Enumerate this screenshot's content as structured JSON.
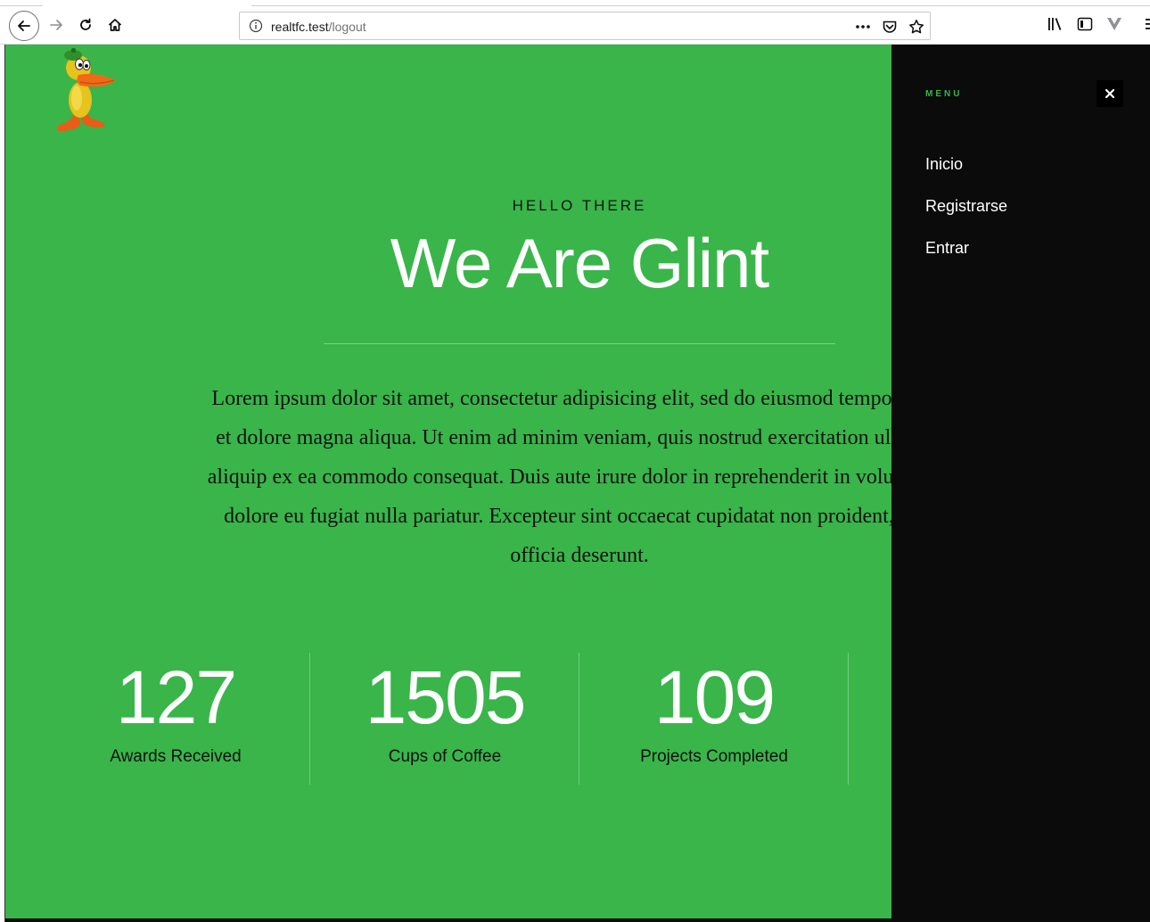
{
  "browser": {
    "url_host": "realtfc.test",
    "url_path": "/logout"
  },
  "hero": {
    "eyebrow": "HELLO THERE",
    "headline": "We Are Glint",
    "intro_lines": [
      "Lorem ipsum dolor sit amet, consectetur adipisicing elit, sed do eiusmod tempor incid",
      "et dolore magna aliqua. Ut enim ad minim veniam, quis nostrud exercitation ullamco",
      "aliquip ex ea commodo consequat. Duis aute irure dolor in reprehenderit in voluptate v",
      "dolore eu fugiat nulla pariatur. Excepteur sint occaecat cupidatat non proident, sunt",
      "officia deserunt."
    ]
  },
  "stats": [
    {
      "number": "127",
      "label": "Awards Received"
    },
    {
      "number": "1505",
      "label": "Cups of Coffee"
    },
    {
      "number": "109",
      "label": "Projects Completed"
    }
  ],
  "menu": {
    "title": "MENU",
    "items": [
      {
        "label": "Inicio"
      },
      {
        "label": "Registrarse"
      },
      {
        "label": "Entrar"
      }
    ]
  },
  "colors": {
    "hero_bg": "#39b54a",
    "menu_bg": "#0b0b0b",
    "menu_accent": "#39b54a"
  },
  "icons": {
    "back": "back-arrow-icon",
    "forward": "forward-arrow-icon",
    "reload": "reload-icon",
    "home": "home-icon",
    "info": "info-icon",
    "more": "more-dots-icon",
    "pocket": "pocket-icon",
    "bookmark": "star-icon",
    "library": "library-icon",
    "sidebar": "sidebar-icon",
    "extension": "vue-devtools-icon",
    "menu": "hamburger-icon",
    "close": "close-icon",
    "logo": "duck-mascot-logo"
  }
}
